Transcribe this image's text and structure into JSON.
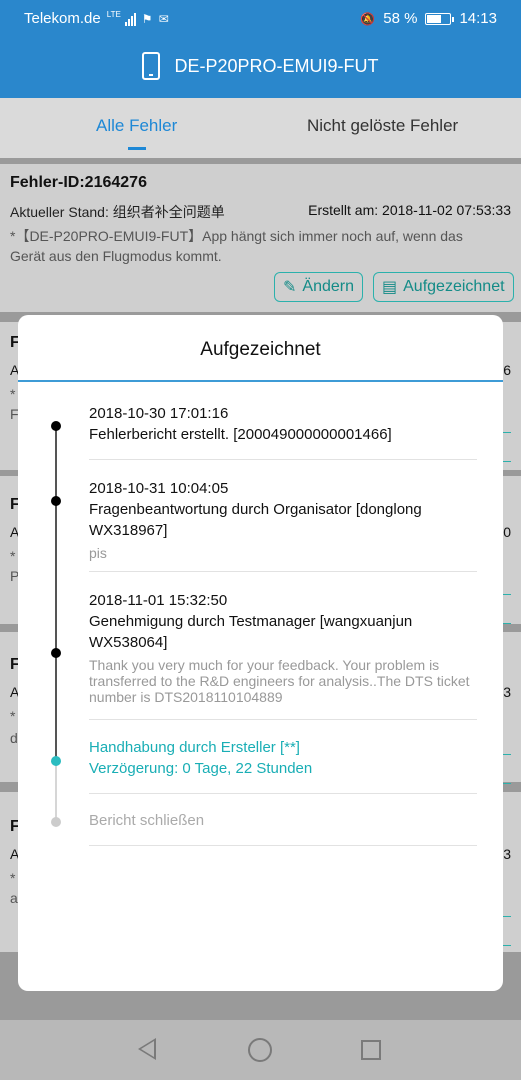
{
  "status_bar": {
    "carrier": "Telekom.de",
    "network": "LTE",
    "battery": "58 %",
    "battery_level": 0.58,
    "time": "14:13"
  },
  "header": {
    "device_title": "DE-P20PRO-EMUI9-FUT"
  },
  "tabs": [
    {
      "label": "Alle Fehler",
      "active": true
    },
    {
      "label": "Nicht gelöste Fehler",
      "active": false
    }
  ],
  "card": {
    "id_label": "Fehler-ID:2164276",
    "state": "Aktueller Stand:  组织者补全问题单",
    "created": "Erstellt am:  2018-11-02 07:53:33",
    "description": "*【DE-P20PRO-EMUI9-FUT】App hängt sich immer noch auf, wenn das Gerät aus den Flugmodus kommt.",
    "edit_label": "Ändern",
    "recorded_label": "Aufgezeichnet"
  },
  "behind_cards": [
    {
      "letter": "F",
      "a": "A",
      "star": "*",
      "line3": "F",
      "digit": "6"
    },
    {
      "letter": "F",
      "a": "A",
      "star": "*",
      "line3": "P",
      "digit": "0"
    },
    {
      "letter": "F",
      "a": "A",
      "star": "*",
      "line3": "d",
      "digit": "3"
    },
    {
      "letter": "F",
      "a": "A",
      "star": "*",
      "line3": "a",
      "digit": "3"
    }
  ],
  "modal": {
    "title": "Aufgezeichnet",
    "entries": [
      {
        "datetime": "2018-10-30 17:01:16",
        "text": "Fehlerbericht erstellt.   [200049000000001466]",
        "note": ""
      },
      {
        "datetime": "2018-10-31 10:04:05",
        "text": "Fragenbeantwortung durch Organisator   [donglong WX318967]",
        "note": "pis"
      },
      {
        "datetime": "2018-11-01 15:32:50",
        "text": "Genehmigung durch Testmanager   [wangxuanjun WX538064]",
        "note": " Thank you very much for your feedback. Your problem is transferred to the R&D engineers for analysis..The DTS ticket number is DTS2018110104889"
      },
      {
        "line1": "Handhabung durch Ersteller   [**]",
        "line2": "Verzögerung: 0 Tage, 22 Stunden"
      },
      {
        "line1": "Bericht schließen"
      }
    ]
  },
  "colors": {
    "header": "#2a87cc",
    "accent": "#1e88d6",
    "teal": "#19aeb5"
  }
}
